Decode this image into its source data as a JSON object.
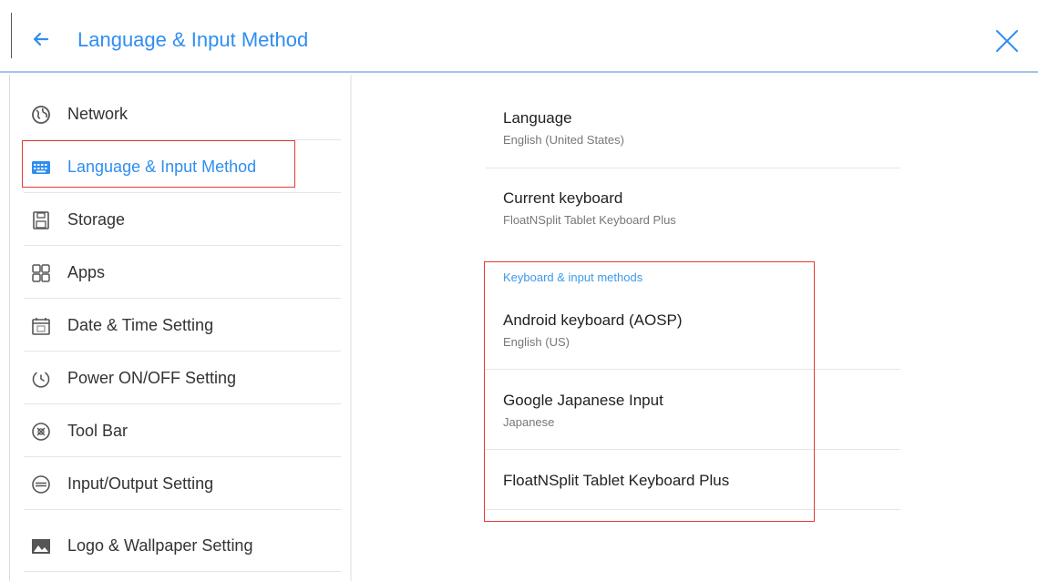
{
  "header": {
    "title": "Language & Input Method",
    "back_icon": "arrow-left-icon",
    "close_icon": "close-icon",
    "accent_color": "#2f8ef0"
  },
  "sidebar": {
    "items": [
      {
        "label": "Network",
        "icon": "globe-icon"
      },
      {
        "label": "Language & Input Method",
        "icon": "keyboard-icon",
        "active": true
      },
      {
        "label": "Storage",
        "icon": "sd-card-icon"
      },
      {
        "label": "Apps",
        "icon": "apps-grid-icon"
      },
      {
        "label": "Date & Time Setting",
        "icon": "calendar-icon"
      },
      {
        "label": "Power ON/OFF Setting",
        "icon": "power-timer-icon"
      },
      {
        "label": "Tool Bar",
        "icon": "toolbar-icon"
      },
      {
        "label": "Input/Output Setting",
        "icon": "input-output-icon"
      },
      {
        "label": "Logo & Wallpaper Setting",
        "icon": "image-icon"
      }
    ]
  },
  "content": {
    "language": {
      "title": "Language",
      "subtitle": "English (United States)"
    },
    "current_keyboard": {
      "title": "Current keyboard",
      "subtitle": "FloatNSplit Tablet Keyboard Plus"
    },
    "section_header": "Keyboard & input methods",
    "input_methods": [
      {
        "title": "Android keyboard (AOSP)",
        "subtitle": "English (US)"
      },
      {
        "title": "Google Japanese Input",
        "subtitle": "Japanese"
      },
      {
        "title": "FloatNSplit Tablet Keyboard Plus",
        "subtitle": ""
      }
    ]
  },
  "colors": {
    "highlight_box": "#e53935",
    "section_header": "#3d9ae8",
    "divider": "#e6e6e6"
  }
}
